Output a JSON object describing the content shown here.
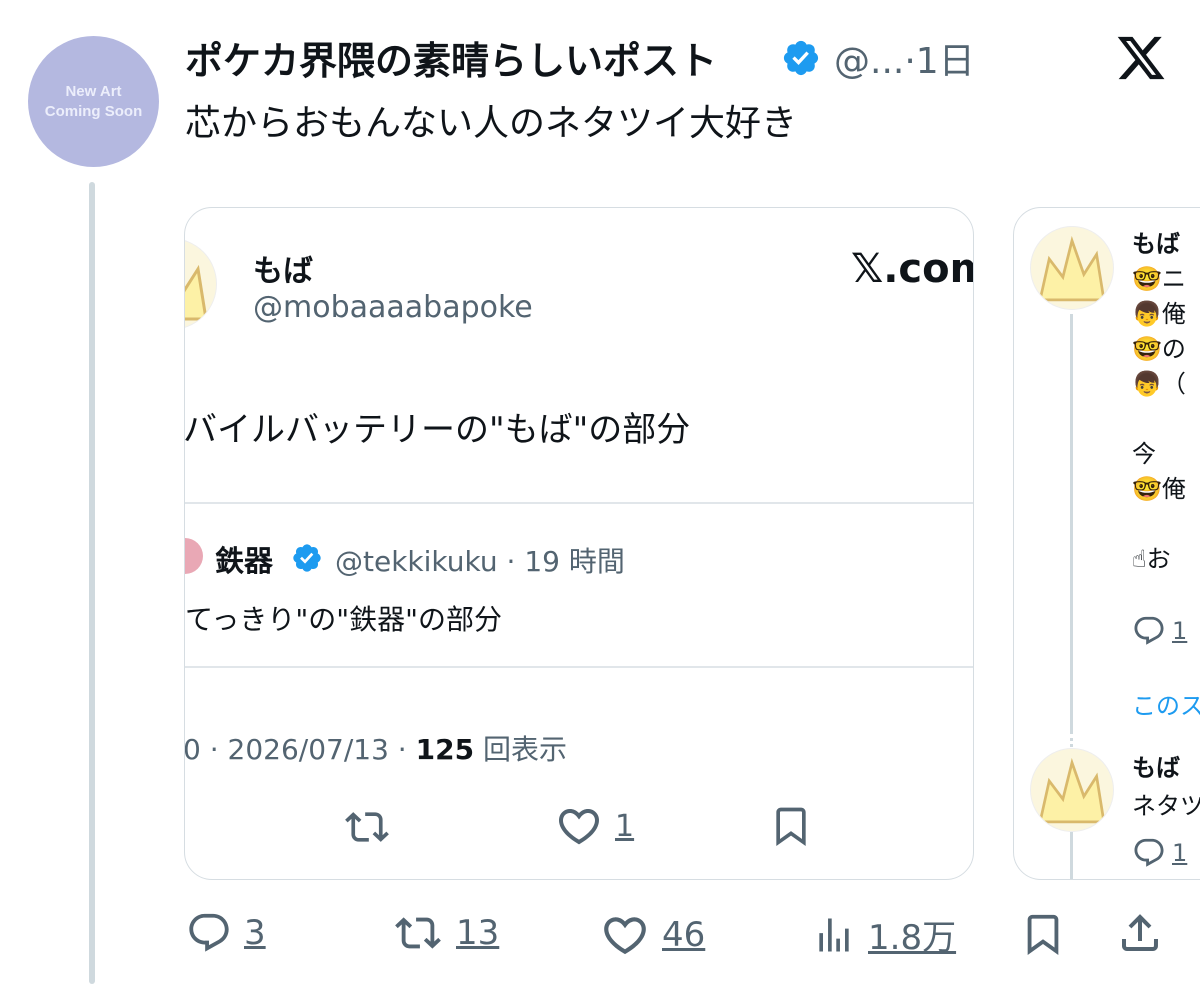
{
  "post": {
    "author_name": "ポケカ界隈の素晴らしいポスト",
    "author_handle": "@...",
    "time": "·1日",
    "text": "芯からおもんない人のネタツイ大好き",
    "avatar_text_1": "New Art",
    "avatar_text_2": "Coming Soon"
  },
  "card1": {
    "author_name": "もば",
    "author_handle": "@mobaaaabapoke",
    "source_label": "𝕏.com",
    "text": "バイルバッテリーの\"もば\"の部分",
    "quote": {
      "name": "鉄器",
      "handle": "@tekkikuku",
      "time": "· 19 時間",
      "text": "てっきり\"の\"鉄器\"の部分"
    },
    "meta_prefix": "0 · 2026/07/13 · ",
    "views_count": "125",
    "views_label": " 回表示",
    "like_count": "1"
  },
  "card2": {
    "rows": [
      {
        "name": "もば",
        "lines": [
          "🤓ニ",
          "👦俺",
          "🤓の",
          "👦（",
          "",
          "今",
          "🤓俺",
          "",
          "☝お"
        ],
        "reply_count": "1"
      },
      {
        "show_more": "このス"
      },
      {
        "name": "もば",
        "lines": [
          "ネタツ"
        ],
        "reply_count": "1"
      }
    ]
  },
  "actions": {
    "replies": "3",
    "reposts": "13",
    "likes": "46",
    "views": "1.8万"
  },
  "colors": {
    "verified": "#1d9bf0",
    "muted": "#536471",
    "link": "#1d9bf0",
    "avatar_bg": "#b4b8e0"
  }
}
